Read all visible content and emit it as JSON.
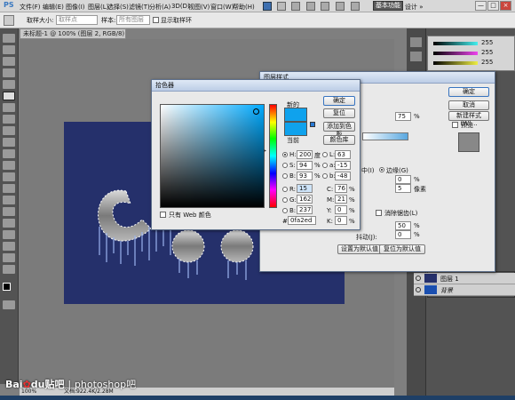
{
  "menubar": {
    "logo": "PS",
    "items": [
      "文件(F)",
      "编辑(E)",
      "图像(I)",
      "图层(L)",
      "选择(S)",
      "滤镜(T)",
      "分析(A)",
      "3D(D)",
      "视图(V)",
      "窗口(W)",
      "帮助(H)"
    ],
    "workspace": "基本功能",
    "workspace_more": "设计 »",
    "win_minimize": "—",
    "win_restore": "□",
    "win_close": "×"
  },
  "options": {
    "sample_size_label": "取样大小:",
    "sample_size_value": "取样点",
    "sample_label": "样本:",
    "sample_value": "所有图层",
    "show_ring_label": "显示取样环"
  },
  "document": {
    "tab_title": "未标题-1 @ 100% (图层 2, RGB/8) ×",
    "zoom": "100%",
    "doc_info": "文档:922.4K/2.28M"
  },
  "color_picker": {
    "title": "拾色器",
    "new_label": "新的",
    "current_label": "当前",
    "ok": "确定",
    "reset": "复位",
    "add_swatch": "添加到色板",
    "color_libraries": "颜色库",
    "web_only": "只有 Web 颜色",
    "H_label": "H:",
    "H": "200",
    "H_unit": "度",
    "S_label": "S:",
    "S": "94",
    "B_label": "B:",
    "B": "93",
    "R_label": "R:",
    "R": "15",
    "G_label": "G:",
    "G": "162",
    "B2_label": "B:",
    "B2": "237",
    "L_label": "L:",
    "L": "63",
    "a_label": "a:",
    "a": "-15",
    "b_label": "b:",
    "b": "-48",
    "C_label": "C:",
    "C": "76",
    "M_label": "M:",
    "M": "21",
    "Y_label": "Y:",
    "Y": "0",
    "K_label": "K:",
    "K": "0",
    "pct": "%",
    "hex_label": "#",
    "hex": "0fa2ed",
    "new_color": "#0fa2ed",
    "current_color": "#0fa2ed"
  },
  "layer_style": {
    "title": "图层样式",
    "ok": "确定",
    "cancel": "取消",
    "new_style": "新建样式(W)...",
    "preview": "预览",
    "opacity": "75",
    "pct": "%",
    "edge_label": "边缘(G)",
    "edge_prefix": "中(I)",
    "field_zero": "0",
    "size": "5",
    "px_unit": "像素",
    "jitter_label": "消除锯齿(L)",
    "range_val": "50",
    "jitter_val": "0",
    "jitter_row_label": "抖动(J):",
    "make_default": "设置为默认值",
    "reset_default": "复位为默认值"
  },
  "layers": {
    "rows": [
      {
        "name": "图层 1"
      },
      {
        "name": "背景"
      }
    ]
  },
  "watermark": {
    "baidu": "Bai",
    "du": "du",
    "tieba": "贴吧",
    "sep": "|",
    "forum": "photoshop吧"
  },
  "swatch_vals": [
    "255",
    "255",
    "255"
  ]
}
